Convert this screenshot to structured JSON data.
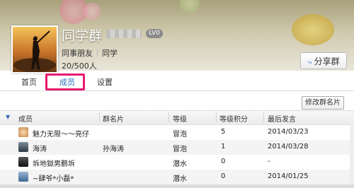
{
  "header": {
    "title": "同学群",
    "level_badge": "LV0",
    "tags": [
      "同事朋友",
      "同学"
    ],
    "member_count": "20/500人",
    "share_button": "分享群"
  },
  "tabs": [
    {
      "label": "首页"
    },
    {
      "label": "成员",
      "active": true
    },
    {
      "label": "设置"
    }
  ],
  "edit_card_button": "修改群名片",
  "table": {
    "columns": [
      "成员",
      "群名片",
      "等级",
      "等级积分",
      "最后发言"
    ],
    "rows": [
      {
        "name": "魅力无限～～亮仔",
        "card": "",
        "level": "冒泡",
        "points": "5",
        "last": "2014/03/23"
      },
      {
        "name": "海涛",
        "card": "孙海涛",
        "level": "冒泡",
        "points": "1",
        "last": "2014/03/28"
      },
      {
        "name": "坼地獄男鹏坼",
        "card": "",
        "level": "潜水",
        "points": "0",
        "last": "-"
      },
      {
        "name": "~肆爷*小磊*",
        "card": "",
        "level": "潜水",
        "points": "0",
        "last": "2014/01/25"
      }
    ]
  },
  "colors": {
    "accent": "#2a6fc0",
    "highlight": "#e8196f"
  }
}
